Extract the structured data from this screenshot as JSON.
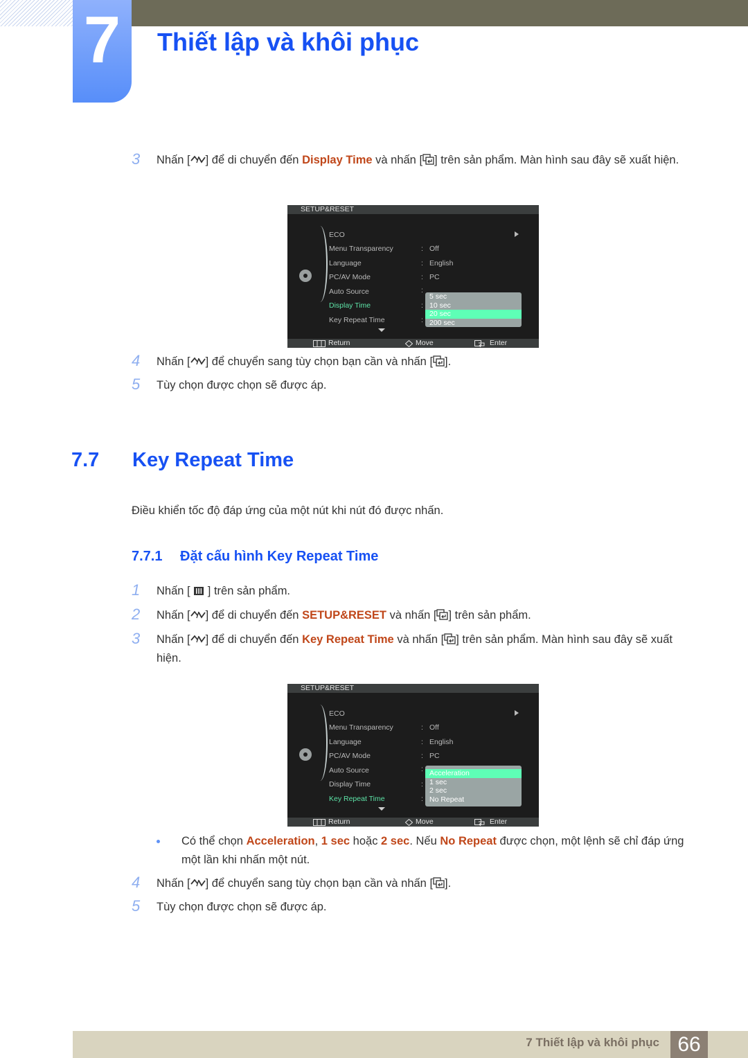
{
  "header": {
    "chapter_number": "7",
    "chapter_title": "Thiết lập và khôi phục"
  },
  "top_steps": [
    {
      "num": "3",
      "parts": [
        "Nhấn [",
        "] để di chuyển đến ",
        "Display Time",
        " và nhấn [",
        "] trên sản phẩm. Màn hình sau đây sẽ xuất hiện."
      ]
    },
    {
      "num": "4",
      "parts": [
        "Nhấn [",
        "] để chuyển sang tùy chọn bạn cần và nhấn [",
        "]."
      ]
    },
    {
      "num": "5",
      "text": "Tùy chọn được chọn sẽ được áp."
    }
  ],
  "osd1": {
    "title": "SETUP&RESET",
    "items": [
      {
        "label": "ECO",
        "value": ""
      },
      {
        "label": "Menu Transparency",
        "value": "Off"
      },
      {
        "label": "Language",
        "value": "English"
      },
      {
        "label": "PC/AV Mode",
        "value": "PC"
      },
      {
        "label": "Auto Source",
        "value": ""
      },
      {
        "label": "Display Time",
        "value": ""
      },
      {
        "label": "Key Repeat Time",
        "value": ""
      }
    ],
    "active_item": "Display Time",
    "options": [
      "5 sec",
      "10 sec",
      "20 sec",
      "200 sec"
    ],
    "selected_option": "20 sec",
    "footer": {
      "return": "Return",
      "move": "Move",
      "enter": "Enter"
    }
  },
  "section": {
    "number": "7.7",
    "title": "Key Repeat Time",
    "description": "Điều khiển tốc độ đáp ứng của một nút khi nút đó được nhấn."
  },
  "subsection": {
    "number": "7.7.1",
    "title": "Đặt cấu hình Key Repeat Time"
  },
  "steps": [
    {
      "num": "1",
      "parts": [
        "Nhấn [ ",
        " ] trên sản phẩm."
      ]
    },
    {
      "num": "2",
      "parts": [
        "Nhấn [",
        "] để di chuyển đến ",
        "SETUP&RESET",
        " và nhấn [",
        "] trên sản phẩm."
      ]
    },
    {
      "num": "3",
      "parts": [
        "Nhấn [",
        "] để di chuyển đến ",
        "Key Repeat Time",
        " và nhấn [",
        "] trên sản phẩm. Màn hình sau đây sẽ xuất hiện."
      ]
    },
    {
      "num": "4",
      "parts": [
        "Nhấn [",
        "] để chuyển sang tùy chọn bạn cần và nhấn [",
        "]."
      ]
    },
    {
      "num": "5",
      "text": "Tùy chọn được chọn sẽ được áp."
    }
  ],
  "osd2": {
    "title": "SETUP&RESET",
    "items": [
      {
        "label": "ECO",
        "value": ""
      },
      {
        "label": "Menu Transparency",
        "value": "Off"
      },
      {
        "label": "Language",
        "value": "English"
      },
      {
        "label": "PC/AV Mode",
        "value": "PC"
      },
      {
        "label": "Auto Source",
        "value": ""
      },
      {
        "label": "Display Time",
        "value": ""
      },
      {
        "label": "Key Repeat Time",
        "value": ""
      }
    ],
    "active_item": "Key Repeat Time",
    "options": [
      "Acceleration",
      "1 sec",
      "2 sec",
      "No Repeat"
    ],
    "selected_option": "Acceleration",
    "footer": {
      "return": "Return",
      "move": "Move",
      "enter": "Enter"
    }
  },
  "note": {
    "parts": [
      "Có thể chọn ",
      "Acceleration",
      ", ",
      "1 sec",
      " hoặc ",
      "2 sec",
      ". Nếu ",
      "No Repeat",
      " được chọn, một lệnh sẽ chỉ đáp ứng một lần khi nhấn một nút."
    ]
  },
  "footer": {
    "chapter_label": "7 Thiết lập và khôi phục",
    "page_number": "66"
  },
  "colors": {
    "heading_blue": "#1751f3",
    "highlight_orange": "#c0471a",
    "osd_active_green": "#5de3a7",
    "osd_selected_bg": "#5effb6"
  }
}
